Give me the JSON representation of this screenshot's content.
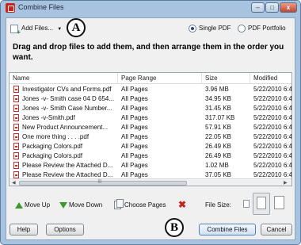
{
  "window": {
    "title": "Combine Files",
    "controls": [
      "–",
      "□",
      "x"
    ]
  },
  "toolbar": {
    "add_files_label": "Add Files...",
    "add_files_icon": "add-file-icon",
    "callout_a": "A",
    "output_options": [
      {
        "label": "Single PDF",
        "selected": true
      },
      {
        "label": "PDF Portfolio",
        "selected": false
      }
    ]
  },
  "instructions": "Drag and drop files to add them, and then arrange them in the order you want.",
  "file_list": {
    "columns": [
      "Name",
      "Page Range",
      "Size",
      "Modified"
    ],
    "rows": [
      {
        "name": "Investigator CVs and Forms.pdf",
        "range": "All Pages",
        "size": "3.96 MB",
        "modified": "5/22/2010 6:4"
      },
      {
        "name": "Jones -v- Smith case 04 D 654...",
        "range": "All Pages",
        "size": "34.95 KB",
        "modified": "5/22/2010 6:4"
      },
      {
        "name": "Jones -v- Smith Case Number...",
        "range": "All Pages",
        "size": "31.45 KB",
        "modified": "5/22/2010 6:4"
      },
      {
        "name": "Jones -v-Smith.pdf",
        "range": "All Pages",
        "size": "317.07 KB",
        "modified": "5/22/2010 6:4"
      },
      {
        "name": "New Product Announcement...",
        "range": "All Pages",
        "size": "57.91 KB",
        "modified": "5/22/2010 6:4"
      },
      {
        "name": "One more thing . . . .pdf",
        "range": "All Pages",
        "size": "22.05 KB",
        "modified": "5/22/2010 6:4"
      },
      {
        "name": "Packaging Colors.pdf",
        "range": "All Pages",
        "size": "26.49 KB",
        "modified": "5/22/2010 6:4"
      },
      {
        "name": "Packaging Colors.pdf",
        "range": "All Pages",
        "size": "26.49 KB",
        "modified": "5/22/2010 6:4"
      },
      {
        "name": "Please Review the Attached D...",
        "range": "All Pages",
        "size": "1.02 MB",
        "modified": "5/22/2010 6:4"
      },
      {
        "name": "Please Review the Attached D...",
        "range": "All Pages",
        "size": "37.05 KB",
        "modified": "5/22/2010 6:4"
      }
    ],
    "scroll_grip": "|||"
  },
  "actions": {
    "move_up": "Move Up",
    "move_down": "Move Down",
    "choose_pages": "Choose Pages",
    "remove_icon": "remove-x-icon",
    "file_size_label": "File Size:"
  },
  "footer": {
    "help": "Help",
    "options": "Options",
    "callout_b": "B",
    "combine": "Combine Files",
    "cancel": "Cancel"
  },
  "colors": {
    "frame": "#a7c3df",
    "pdf_red": "#c23127",
    "arrow_green": "#3b9a2a"
  }
}
